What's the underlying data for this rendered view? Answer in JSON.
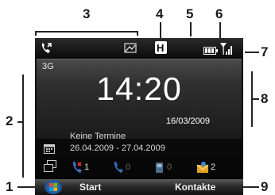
{
  "callouts": {
    "c1": "1",
    "c2": "2",
    "c3": "3",
    "c4": "4",
    "c5": "5",
    "c6": "6",
    "c7": "7",
    "c8": "8",
    "c9": "9"
  },
  "status": {
    "phone_icon": "phone-forward-icon",
    "msg_icon": "message-status-icon",
    "h_icon": "hsdpa-icon",
    "h_label": "H",
    "data_icon": "data-activity-icon",
    "battery_icon": "battery-icon",
    "signal_icon": "signal-strength-icon"
  },
  "clock": {
    "network": "3G",
    "time": "14:20",
    "date": "16/03/2009"
  },
  "appointments": {
    "title": "Keine Termine",
    "range": "26.04.2009 - 27.04.2009"
  },
  "notifications": {
    "missed_calls": "1",
    "voicemail": "0",
    "sms": "0",
    "email": "2"
  },
  "softkeys": {
    "left": "Start",
    "right": "Kontakte"
  },
  "colors": {
    "missed": "#d93a2b",
    "voicemail": "#2f6fb8",
    "sms": "#4a78a8",
    "email": "#e5a420"
  }
}
